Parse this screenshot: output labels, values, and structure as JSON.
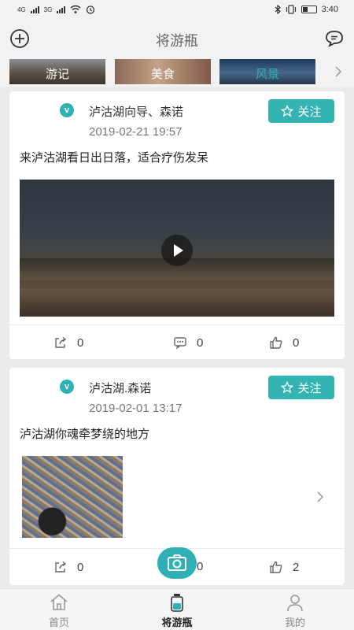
{
  "status_bar": {
    "left_label_1": "4G",
    "left_label_2": "3G",
    "time": "3:40",
    "icons": [
      "signal-icon",
      "signal-icon",
      "wifi-icon",
      "alarm-icon",
      "bluetooth-icon",
      "vibrate-icon",
      "battery-icon"
    ]
  },
  "header": {
    "title": "将游瓶",
    "left_icon": "add-circle-icon",
    "right_icon": "message-icon"
  },
  "categories": [
    {
      "label": "游记",
      "active": false
    },
    {
      "label": "美食",
      "active": false
    },
    {
      "label": "风景",
      "active": true
    }
  ],
  "posts": [
    {
      "author": "泸沽湖向导、森诺",
      "time": "2019-02-21 19:57",
      "text": "来泸沽湖看日出日落，适合疗伤发呆",
      "media": "video",
      "follow_label": "关注",
      "shares": "0",
      "comments": "0",
      "likes": "0"
    },
    {
      "author": "泸沽湖.森诺",
      "time": "2019-02-01 13:17",
      "text": "泸沽湖你魂牵梦绕的地方",
      "media": "photo",
      "follow_label": "关注",
      "shares": "0",
      "comments": "0",
      "likes": "2"
    }
  ],
  "tabs": [
    {
      "label": "首页",
      "icon": "home-icon",
      "active": false
    },
    {
      "label": "将游瓶",
      "icon": "bottle-icon",
      "active": true
    },
    {
      "label": "我的",
      "icon": "user-icon",
      "active": false
    }
  ],
  "colors": {
    "accent": "#33b3b1",
    "background": "#ebebeb",
    "card": "#ffffff"
  }
}
